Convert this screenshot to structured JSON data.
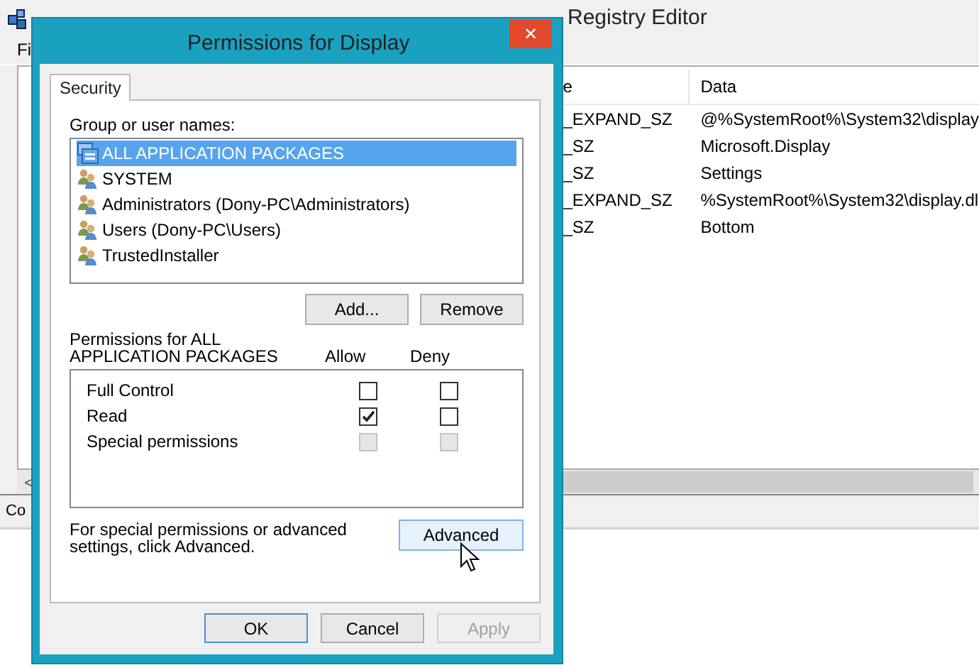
{
  "registry_editor": {
    "title": "Registry Editor",
    "menu": [
      "Fi"
    ],
    "columns": [
      "e",
      "Data"
    ],
    "rows": [
      {
        "type": "_EXPAND_SZ",
        "data": "@%SystemRoot%\\System32\\display"
      },
      {
        "type": "_SZ",
        "data": "Microsoft.Display"
      },
      {
        "type": "_SZ",
        "data": "Settings"
      },
      {
        "type": "_EXPAND_SZ",
        "data": "%SystemRoot%\\System32\\display.dl"
      },
      {
        "type": "_SZ",
        "data": "Bottom"
      }
    ],
    "scroll_left": "<",
    "status_bar": "Co"
  },
  "dialog": {
    "title": "Permissions for Display",
    "close": "✕",
    "tabs": [
      {
        "label": "Security",
        "selected": true
      }
    ],
    "group_label": "Group or user names:",
    "users": [
      {
        "name": "ALL APPLICATION PACKAGES",
        "kind": "package",
        "selected": true
      },
      {
        "name": "SYSTEM",
        "kind": "group",
        "selected": false
      },
      {
        "name": "Administrators (Dony-PC\\Administrators)",
        "kind": "group",
        "selected": false
      },
      {
        "name": "Users (Dony-PC\\Users)",
        "kind": "group",
        "selected": false
      },
      {
        "name": "TrustedInstaller",
        "kind": "group",
        "selected": false
      }
    ],
    "user_buttons": [
      "Add...",
      "Remove"
    ],
    "permissions_label": "Permissions for ALL APPLICATION PACKAGES",
    "permission_columns": [
      "Allow",
      "Deny"
    ],
    "permissions": [
      {
        "name": "Full Control",
        "allow": false,
        "deny": false,
        "disabled": false
      },
      {
        "name": "Read",
        "allow": true,
        "deny": false,
        "disabled": false
      },
      {
        "name": "Special permissions",
        "allow": false,
        "deny": false,
        "disabled": true
      }
    ],
    "advanced_note": "For special permissions or advanced settings, click Advanced.",
    "advanced_button": {
      "label": "Advanced",
      "hovered": true
    },
    "buttons": [
      {
        "label": "OK",
        "disabled": false,
        "default": true
      },
      {
        "label": "Cancel",
        "disabled": false,
        "default": false
      },
      {
        "label": "Apply",
        "disabled": true,
        "default": false
      }
    ]
  }
}
